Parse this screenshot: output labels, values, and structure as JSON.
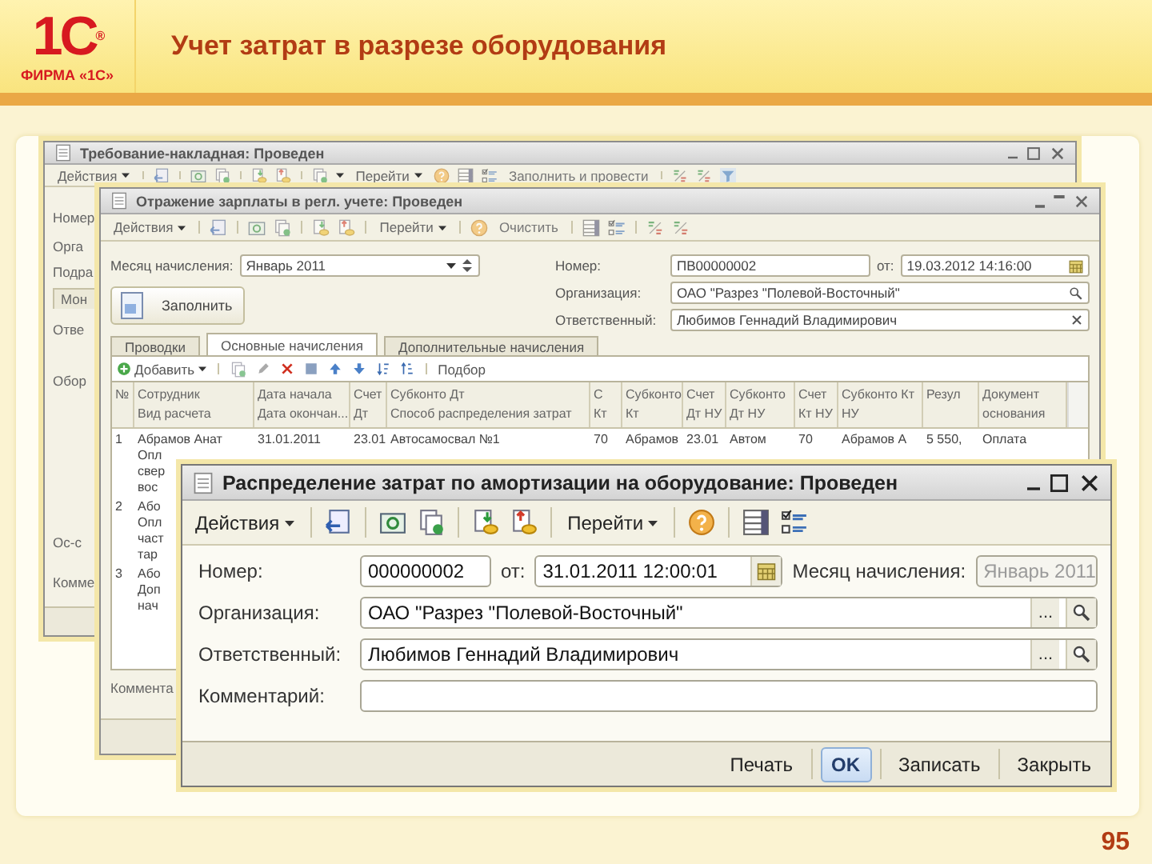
{
  "slide": {
    "logo": {
      "mark": "1С",
      "registered": "®",
      "caption": "ФИРМА «1С»"
    },
    "title": "Учет затрат в разрезе оборудования",
    "page_number": "95"
  },
  "back_window": {
    "title": "Требование-накладная: Проведен",
    "menus": [
      "Действия",
      "Перейти"
    ],
    "toolbar_button": "Заполнить и провести",
    "strip": [
      {
        "kind": "label",
        "text": "Номер"
      },
      {
        "kind": "label",
        "text": "Орга"
      },
      {
        "kind": "label",
        "text": "Подра"
      },
      {
        "kind": "tab",
        "text": "Мон"
      },
      {
        "kind": "label",
        "text": "Отве"
      },
      {
        "kind": "label",
        "text": "Обор"
      },
      {
        "kind": "label",
        "text": "Ос-с"
      },
      {
        "kind": "label",
        "text": "Комме"
      }
    ]
  },
  "middle_window": {
    "title": "Отражение зарплаты в регл. учете: Проведен",
    "menus": [
      "Действия",
      "Перейти"
    ],
    "toolbar_button": "Очистить",
    "month": {
      "label": "Месяц начисления:",
      "value": "Январь 2011"
    },
    "number": {
      "label": "Номер:",
      "value": "ПВ00000002"
    },
    "date": {
      "label": "от:",
      "value": "19.03.2012 14:16:00"
    },
    "organization": {
      "label": "Организация:",
      "value": "ОАО \"Разрез \"Полевой-Восточный\""
    },
    "responsible": {
      "label": "Ответственный:",
      "value": "Любимов Геннадий Владимирович"
    },
    "fill_button": "Заполнить",
    "tabs": [
      {
        "label": "Проводки",
        "selected": false
      },
      {
        "label": "Основные начисления",
        "selected": true
      },
      {
        "label": "Дополнительные начисления",
        "selected": false
      }
    ],
    "table_toolbar": {
      "add": "Добавить",
      "pick": "Подбор"
    },
    "columns": [
      {
        "lines": [
          "№"
        ]
      },
      {
        "lines": [
          "Сотрудник",
          "Вид расчета"
        ]
      },
      {
        "lines": [
          "Дата начала",
          "Дата окончан..."
        ]
      },
      {
        "lines": [
          "Счет",
          "Дт"
        ]
      },
      {
        "lines": [
          "Субконто Дт",
          "Способ распределения затрат"
        ]
      },
      {
        "lines": [
          "С",
          "Кт"
        ]
      },
      {
        "lines": [
          "Субконто",
          "Кт"
        ]
      },
      {
        "lines": [
          "Счет",
          "Дт НУ"
        ]
      },
      {
        "lines": [
          "Субконто",
          "Дт НУ"
        ]
      },
      {
        "lines": [
          "Счет",
          "Кт НУ"
        ]
      },
      {
        "lines": [
          "Субконто Кт",
          "НУ"
        ]
      },
      {
        "lines": [
          "Резул"
        ]
      },
      {
        "lines": [
          "Документ",
          "основания"
        ]
      }
    ],
    "rows": [
      {
        "cells": [
          "1",
          "Абрамов Анат",
          "31.01.2011",
          "23.01",
          "Автосамосвал №1",
          "70",
          "Абрамов",
          "23.01",
          "Автом",
          "70",
          "Абрамов А",
          "5 550,",
          "Оплата"
        ],
        "lines": [
          "Опл",
          "свер",
          "вос"
        ]
      },
      {
        "cells": [
          "2",
          "Або"
        ],
        "lines": [
          "Опл",
          "част",
          "тар"
        ]
      },
      {
        "cells": [
          "3",
          "Або"
        ],
        "lines": [
          "Доп",
          "нач"
        ]
      }
    ],
    "comment_label": "Коммента"
  },
  "front_window": {
    "title": "Распределение затрат по амортизации на оборудование: Проведен",
    "menus": [
      "Действия",
      "Перейти"
    ],
    "number": {
      "label": "Номер:",
      "value": "000000002"
    },
    "date": {
      "label": "от:",
      "value": "31.01.2011 12:00:01"
    },
    "month": {
      "label": "Месяц начисления:",
      "value": "Январь 2011",
      "disabled": true
    },
    "organization": {
      "label": "Организация:",
      "value": "ОАО \"Разрез \"Полевой-Восточный\"",
      "choose": "..."
    },
    "responsible": {
      "label": "Ответственный:",
      "value": "Любимов Геннадий Владимирович",
      "choose": "..."
    },
    "comment": {
      "label": "Комментарий:"
    },
    "buttons": [
      {
        "label": "Печать",
        "default": false
      },
      {
        "label": "OK",
        "default": true
      },
      {
        "label": "Записать",
        "default": false
      },
      {
        "label": "Закрыть",
        "default": false
      }
    ]
  }
}
